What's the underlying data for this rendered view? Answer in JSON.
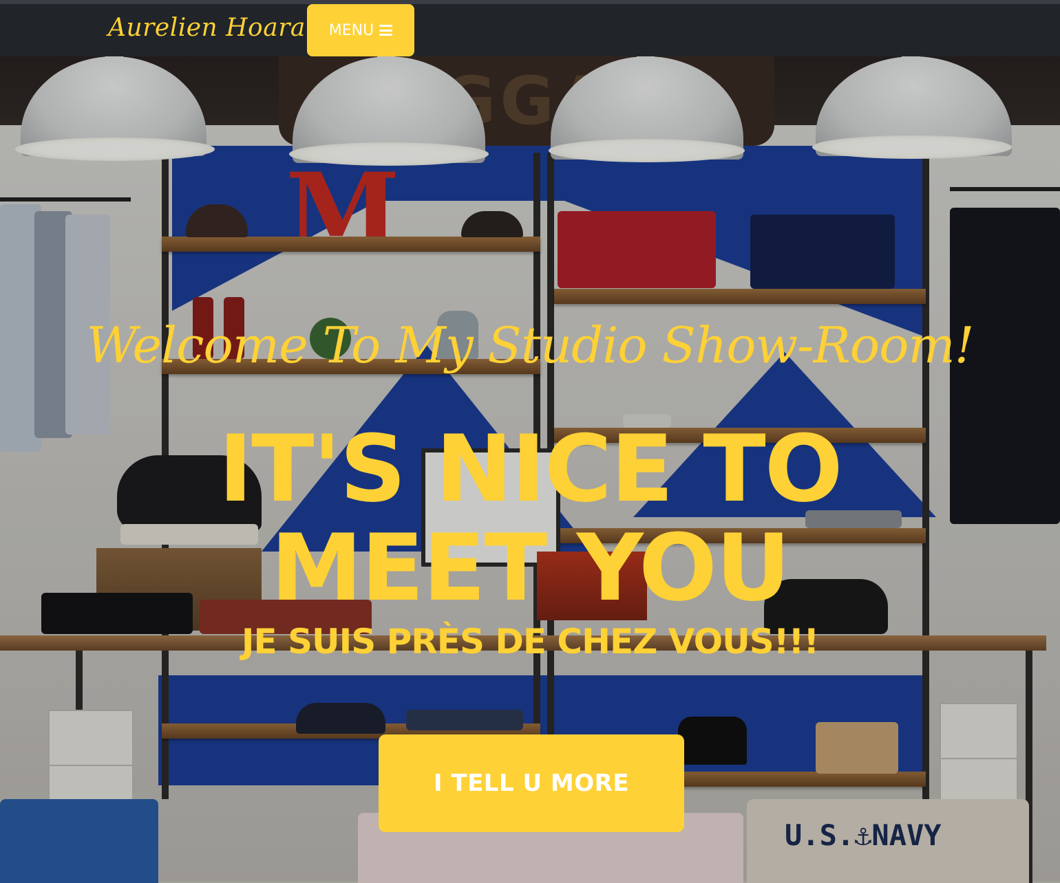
{
  "navbar": {
    "brand": "Aurelien Hoarau",
    "menu_label": "MENU",
    "menu_icon": "hamburger-icon"
  },
  "hero": {
    "background_image": "clothing-store-interior",
    "background_sign_text": "BAGGAGE",
    "subheading": "Welcome To My Studio Show-Room!",
    "heading_line1": "IT'S NICE TO",
    "heading_line2": "MEET YOU",
    "tagline": "JE SUIS PRÈS DE CHEZ VOUS!!!",
    "cta_label": "I TELL U MORE",
    "shirt_text": "U.S.⚓NAVY"
  },
  "colors": {
    "accent": "#fed136",
    "navbar_bg": "#212529",
    "button_text": "#ffffff"
  }
}
